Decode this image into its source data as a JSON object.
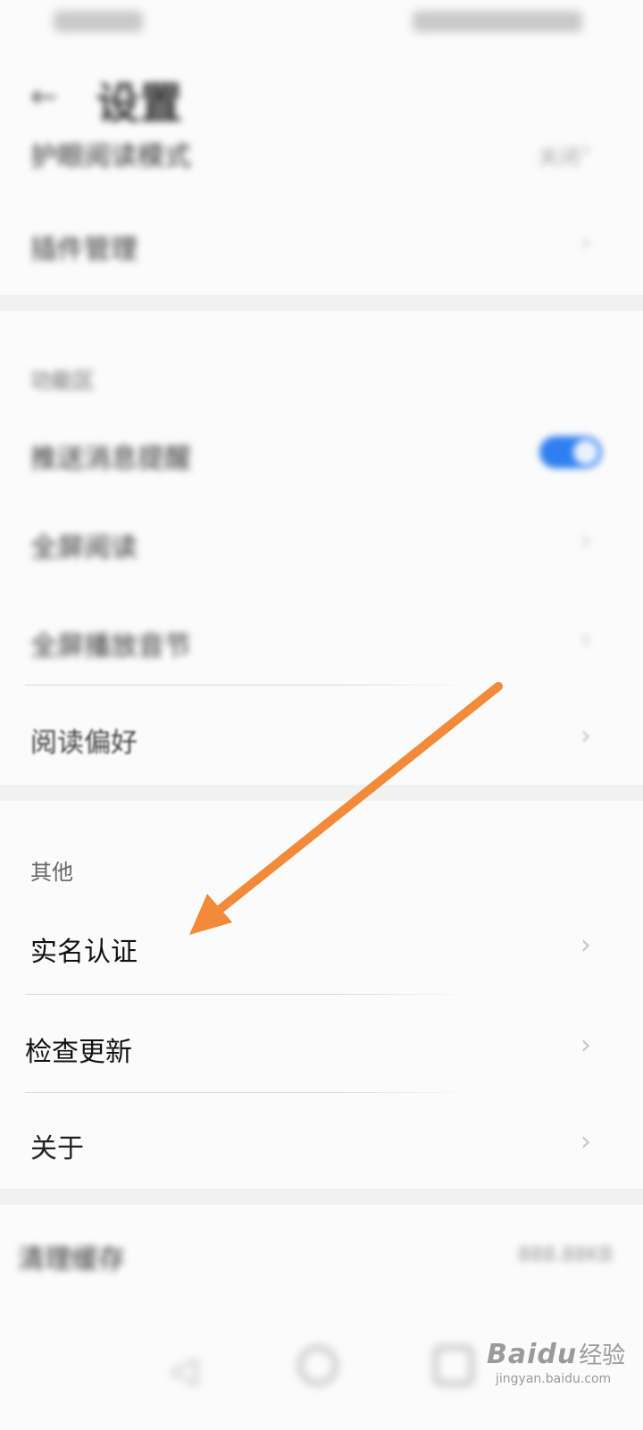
{
  "status_bar": {},
  "header": {
    "back_icon": "back-arrow-icon",
    "title": "设置"
  },
  "top_section": {
    "items": [
      {
        "label": "护眼阅读模式",
        "value": "关闭"
      },
      {
        "label": "插件管理"
      }
    ]
  },
  "feature_section": {
    "title": "功能区",
    "items": [
      {
        "label": "推送消息提醒",
        "toggle_on": true
      },
      {
        "label": "全屏阅读"
      },
      {
        "label": "全屏播放音节"
      },
      {
        "label": "阅读偏好"
      }
    ]
  },
  "other_section": {
    "title": "其他",
    "items": [
      {
        "label": "实名认证"
      },
      {
        "label": "检查更新"
      },
      {
        "label": "关于"
      }
    ]
  },
  "clear_cache": {
    "label": "清理缓存",
    "value": "888.88KB"
  },
  "annotation": {
    "arrow_color": "#f28a3a"
  },
  "watermark": {
    "logo": "Baidu",
    "cn": "经验",
    "url": "jingyan.baidu.com"
  },
  "colors": {
    "toggle_on": "#2f7ff0",
    "background": "#fbfbfb"
  }
}
